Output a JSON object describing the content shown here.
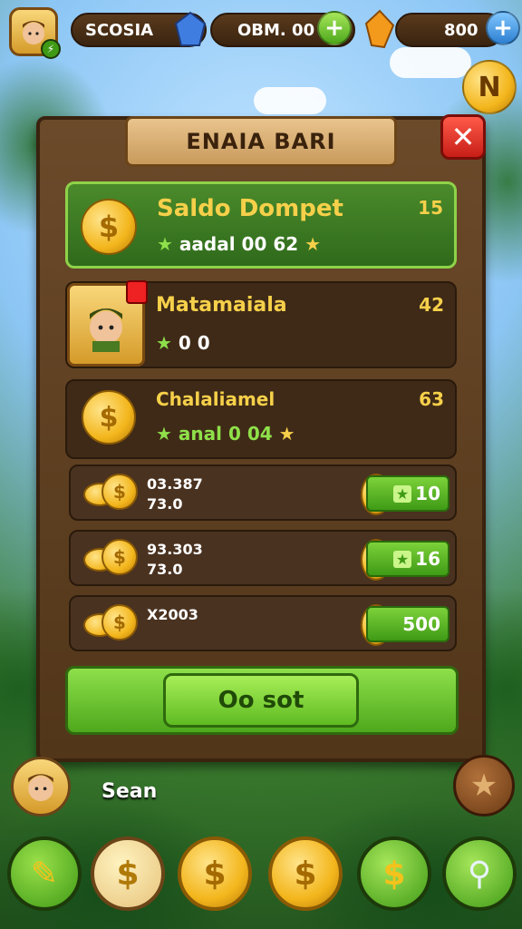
{
  "topbar": {
    "player_name": "SCOSIA",
    "gems_value": "OBM. 00",
    "gold_value": "800",
    "n_badge": "N"
  },
  "dialog": {
    "title": "ENAIA BARI",
    "cards": [
      {
        "title": "Saldo Dompet",
        "subtitle": "aadal 00 62",
        "number": "15"
      },
      {
        "title": "Matamaiala",
        "subtitle": "0 0",
        "number": "42"
      },
      {
        "title": "Chalaliamel",
        "subtitle": "anal 0 04",
        "number": "63"
      }
    ],
    "rows": [
      {
        "line1": "03.387",
        "line2": "73.0",
        "price": "10"
      },
      {
        "line1": "93.303",
        "line2": "73.0",
        "price": "16"
      },
      {
        "line1": "X2003",
        "line2": "",
        "price": "500"
      }
    ],
    "buy_label": "Oo sot"
  },
  "player": {
    "name": "Sean"
  },
  "colors": {
    "panel_wood": "#523619",
    "accent_green": "#5fbb22",
    "coin_gold": "#f3b61c",
    "close_red": "#c71e16"
  },
  "icons": [
    "star-icon",
    "coin-icon",
    "plus-icon",
    "close-icon",
    "search-icon",
    "gem-icon",
    "trophy-icon"
  ]
}
